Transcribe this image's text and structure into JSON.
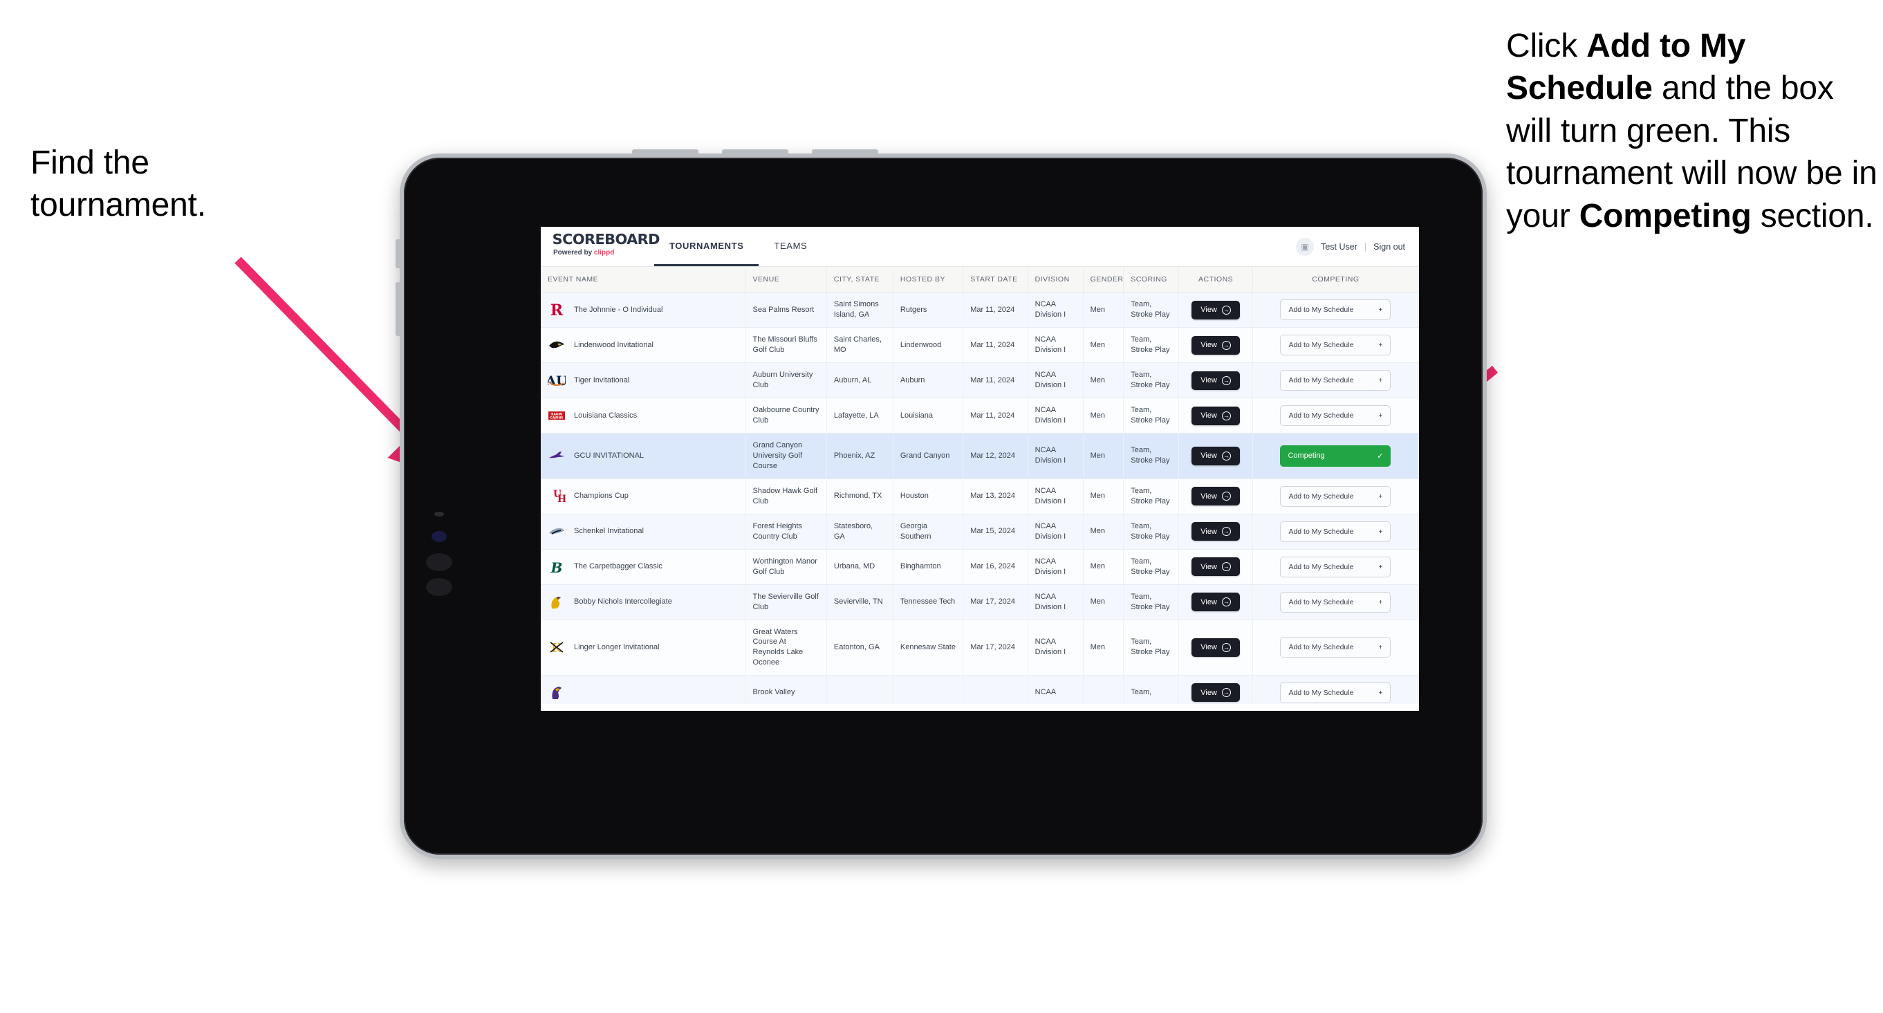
{
  "annotations": {
    "left": "Find the tournament.",
    "right_parts": [
      {
        "t": "Click ",
        "b": false
      },
      {
        "t": "Add to My Schedule",
        "b": true
      },
      {
        "t": " and the box will turn green. This tournament will now be in your ",
        "b": false
      },
      {
        "t": "Competing",
        "b": true
      },
      {
        "t": " section.",
        "b": false
      }
    ]
  },
  "colors": {
    "accent_pink": "#ef3e63",
    "arrow_pink": "#ee2a6b",
    "competing_green": "#22a544",
    "view_dark": "#1b1d26",
    "row_selected": "#dbe7fb"
  },
  "app": {
    "brand": {
      "name": "SCOREBOARD",
      "powered_prefix": "Powered by ",
      "powered_brand": "clippd"
    },
    "nav": [
      {
        "label": "TOURNAMENTS",
        "active": true
      },
      {
        "label": "TEAMS",
        "active": false
      }
    ],
    "user": {
      "name": "Test User",
      "separator": "|",
      "signout": "Sign out",
      "avatar_glyph": "▣"
    },
    "table": {
      "columns": [
        "EVENT NAME",
        "VENUE",
        "CITY, STATE",
        "HOSTED BY",
        "START DATE",
        "DIVISION",
        "GENDER",
        "SCORING",
        "ACTIONS",
        "COMPETING"
      ],
      "view_label": "View",
      "add_label": "Add to My Schedule",
      "add_plus": "+",
      "competing_label": "Competing",
      "competing_check": "✓",
      "rows": [
        {
          "logo": "rutgers",
          "event": "The Johnnie - O Individual",
          "venue": "Sea Palms Resort",
          "city": "Saint Simons Island, GA",
          "host": "Rutgers",
          "date": "Mar 11, 2024",
          "division": "NCAA Division I",
          "gender": "Men",
          "scoring": "Team, Stroke Play",
          "competing": false
        },
        {
          "logo": "lindenwood",
          "event": "Lindenwood Invitational",
          "venue": "The Missouri Bluffs Golf Club",
          "city": "Saint Charles, MO",
          "host": "Lindenwood",
          "date": "Mar 11, 2024",
          "division": "NCAA Division I",
          "gender": "Men",
          "scoring": "Team, Stroke Play",
          "competing": false
        },
        {
          "logo": "auburn",
          "event": "Tiger Invitational",
          "venue": "Auburn University Club",
          "city": "Auburn, AL",
          "host": "Auburn",
          "date": "Mar 11, 2024",
          "division": "NCAA Division I",
          "gender": "Men",
          "scoring": "Team, Stroke Play",
          "competing": false
        },
        {
          "logo": "louisiana",
          "event": "Louisiana Classics",
          "venue": "Oakbourne Country Club",
          "city": "Lafayette, LA",
          "host": "Louisiana",
          "date": "Mar 11, 2024",
          "division": "NCAA Division I",
          "gender": "Men",
          "scoring": "Team, Stroke Play",
          "competing": false
        },
        {
          "logo": "gcu",
          "event": "GCU INVITATIONAL",
          "venue": "Grand Canyon University Golf Course",
          "city": "Phoenix, AZ",
          "host": "Grand Canyon",
          "date": "Mar 12, 2024",
          "division": "NCAA Division I",
          "gender": "Men",
          "scoring": "Team, Stroke Play",
          "competing": true
        },
        {
          "logo": "houston",
          "event": "Champions Cup",
          "venue": "Shadow Hawk Golf Club",
          "city": "Richmond, TX",
          "host": "Houston",
          "date": "Mar 13, 2024",
          "division": "NCAA Division I",
          "gender": "Men",
          "scoring": "Team, Stroke Play",
          "competing": false
        },
        {
          "logo": "georgiasouthern",
          "event": "Schenkel Invitational",
          "venue": "Forest Heights Country Club",
          "city": "Statesboro, GA",
          "host": "Georgia Southern",
          "date": "Mar 15, 2024",
          "division": "NCAA Division I",
          "gender": "Men",
          "scoring": "Team, Stroke Play",
          "competing": false
        },
        {
          "logo": "binghamton",
          "event": "The Carpetbagger Classic",
          "venue": "Worthington Manor Golf Club",
          "city": "Urbana, MD",
          "host": "Binghamton",
          "date": "Mar 16, 2024",
          "division": "NCAA Division I",
          "gender": "Men",
          "scoring": "Team, Stroke Play",
          "competing": false
        },
        {
          "logo": "tennesseetech",
          "event": "Bobby Nichols Intercollegiate",
          "venue": "The Sevierville Golf Club",
          "city": "Sevierville, TN",
          "host": "Tennessee Tech",
          "date": "Mar 17, 2024",
          "division": "NCAA Division I",
          "gender": "Men",
          "scoring": "Team, Stroke Play",
          "competing": false
        },
        {
          "logo": "kennesaw",
          "event": "Linger Longer Invitational",
          "venue": "Great Waters Course At Reynolds Lake Oconee",
          "city": "Eatonton, GA",
          "host": "Kennesaw State",
          "date": "Mar 17, 2024",
          "division": "NCAA Division I",
          "gender": "Men",
          "scoring": "Team, Stroke Play",
          "competing": false
        },
        {
          "logo": "ecu",
          "event": "",
          "venue": "Brook Valley",
          "city": "",
          "host": "",
          "date": "",
          "division": "NCAA",
          "gender": "",
          "scoring": "Team,",
          "competing": false
        }
      ]
    }
  }
}
